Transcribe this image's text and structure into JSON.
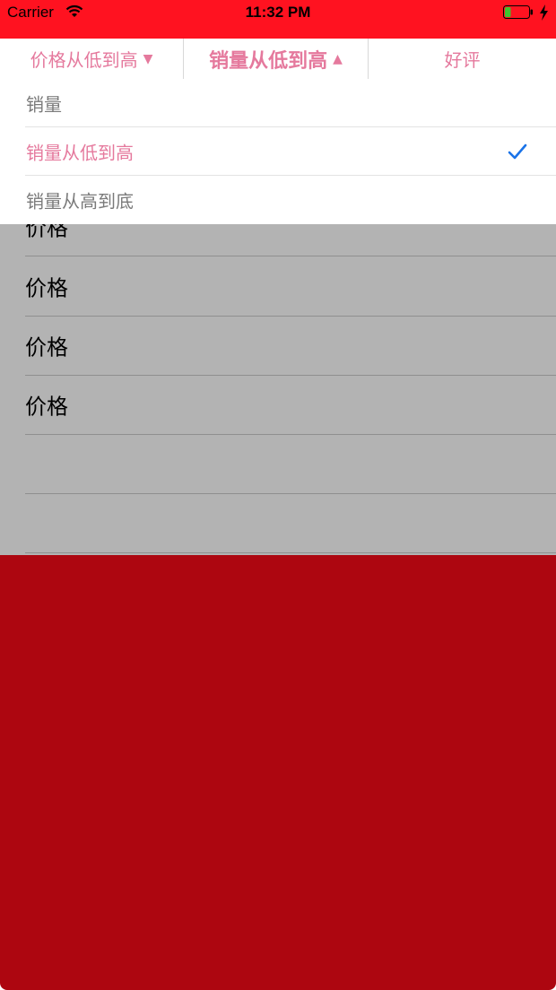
{
  "status_bar": {
    "carrier": "Carrier",
    "time": "11:32 PM",
    "battery_level": 0.25
  },
  "filter_bar": {
    "tabs": [
      {
        "label": "价格从低到高",
        "arrow": "▼",
        "active": false
      },
      {
        "label": "销量从低到高",
        "arrow": "▲",
        "active": true
      },
      {
        "label": "好评",
        "arrow": "",
        "active": false
      }
    ]
  },
  "dropdown": {
    "items": [
      {
        "label": "销量",
        "selected": false
      },
      {
        "label": "销量从低到高",
        "selected": true
      },
      {
        "label": "销量从高到底",
        "selected": false
      }
    ]
  },
  "list": {
    "rows": [
      {
        "label": "价格"
      },
      {
        "label": "价格"
      },
      {
        "label": "价格"
      },
      {
        "label": "价格"
      },
      {
        "label": ""
      },
      {
        "label": ""
      }
    ]
  },
  "colors": {
    "status_bar": "#ff1220",
    "accent_pink": "#e5799d",
    "checkmark_blue": "#1a73e8",
    "dim_background": "#b3b3b3",
    "overlay_red": "#ad0610"
  }
}
